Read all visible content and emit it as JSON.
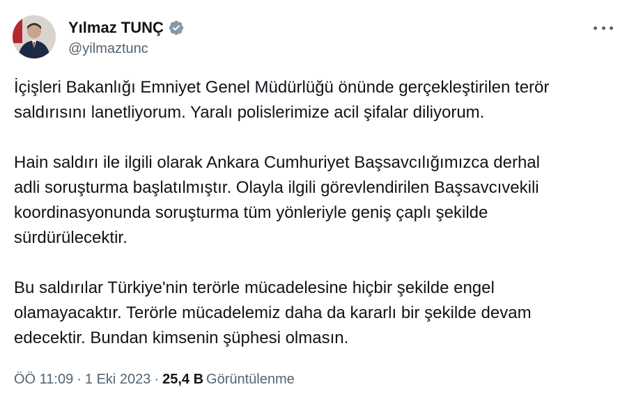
{
  "author": {
    "name": "Yılmaz TUNÇ",
    "handle": "@yilmaztunc"
  },
  "tweet": {
    "paragraphs": [
      [
        "İçişleri Bakanlığı Emniyet Genel Müdürlüğü önünde gerçekleştirilen terör",
        "saldırısını lanetliyorum. Yaralı polislerimize acil şifalar diliyorum."
      ],
      [
        "Hain saldırı ile ilgili olarak Ankara Cumhuriyet Başsavcılığımızca derhal",
        "adli soruşturma başlatılmıştır. Olayla ilgili görevlendirilen Başsavcıvekili",
        "koordinasyonunda soruşturma tüm yönleriyle geniş çaplı şekilde",
        "sürdürülecektir."
      ],
      [
        "Bu saldırılar Türkiye'nin terörle mücadelesine hiçbir şekilde engel",
        "olamayacaktır. Terörle mücadelemiz daha da kararlı bir şekilde devam",
        "edecektir. Bundan kimsenin şüphesi olmasın."
      ]
    ]
  },
  "meta": {
    "time": "ÖÖ 11:09",
    "separator": "·",
    "date": "1 Eki 2023",
    "views_count": "25,4 B",
    "views_label": "Görüntülenme"
  },
  "colors": {
    "text": "#0f1419",
    "secondary": "#536471",
    "verified": "#829aab"
  },
  "icons": {
    "verified": "verified-badge-icon",
    "more": "more-options-icon"
  }
}
